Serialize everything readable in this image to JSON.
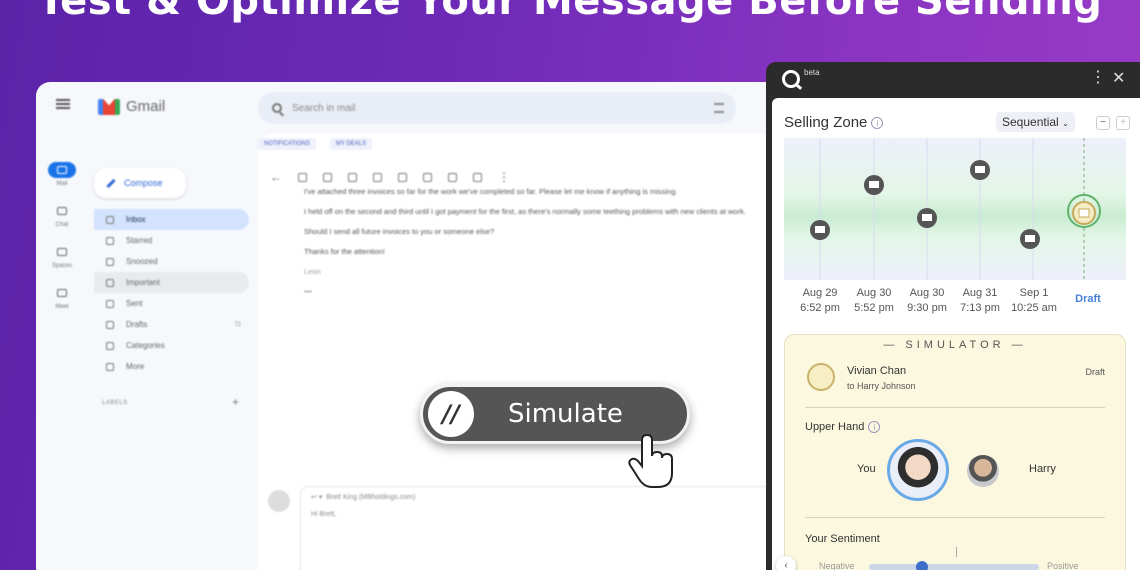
{
  "headline": "Test & Optimize Your Message Before Sending",
  "gmail": {
    "app_name": "Gmail",
    "search_placeholder": "Search in mail",
    "compose_label": "Compose",
    "chips": [
      "NOTIFICATIONS",
      "MY DEALS"
    ],
    "rail": [
      {
        "label": "Mail",
        "icon": "mail-icon"
      },
      {
        "label": "Chat",
        "icon": "chat-icon"
      },
      {
        "label": "Spaces",
        "icon": "spaces-icon"
      },
      {
        "label": "Meet",
        "icon": "meet-icon"
      }
    ],
    "nav": [
      {
        "label": "Inbox",
        "icon": "inbox-icon"
      },
      {
        "label": "Starred",
        "icon": "star-icon"
      },
      {
        "label": "Snoozed",
        "icon": "clock-icon"
      },
      {
        "label": "Important",
        "icon": "important-icon"
      },
      {
        "label": "Sent",
        "icon": "send-icon"
      },
      {
        "label": "Drafts",
        "icon": "draft-icon",
        "count": "72"
      },
      {
        "label": "Categories",
        "icon": "label-icon"
      },
      {
        "label": "More",
        "icon": "chevron-down-icon"
      }
    ],
    "labels_heading": "LABELS",
    "message_lines": [
      "I've attached three invoices so far for the work we've completed so far. Please let me know if anything is missing.",
      "I held off on the second and third until I got payment for the first, as there's normally some teething problems with new clients at work.",
      "Should I send all future invoices to you or someone else?",
      "Thanks for the attention!",
      "Leon"
    ],
    "reply_to": "Brett King (MBholdings.com)",
    "reply_greeting": "Hi Brett,"
  },
  "simulate_label": "Simulate",
  "panel": {
    "beta": "beta",
    "selling_zone_title": "Selling Zone",
    "mode": "Sequential",
    "timeline": [
      {
        "date": "Aug 29",
        "time": "6:52 pm"
      },
      {
        "date": "Aug 30",
        "time": "5:52 pm"
      },
      {
        "date": "Aug 30",
        "time": "9:30 pm"
      },
      {
        "date": "Aug 31",
        "time": "7:13 pm"
      },
      {
        "date": "Sep 1",
        "time": "10:25 am"
      }
    ],
    "draft_label": "Draft",
    "simulator": {
      "heading": "— SIMULATOR —",
      "sender": "Vivian Chan",
      "recipient": "to Harry Johnson",
      "status": "Draft",
      "upper_hand_label": "Upper Hand",
      "you_label": "You",
      "other_label": "Harry",
      "sentiment_label": "Your Sentiment",
      "neg_label": "Negative",
      "pos_label": "Positive",
      "sentiment_value": 0.3
    }
  }
}
